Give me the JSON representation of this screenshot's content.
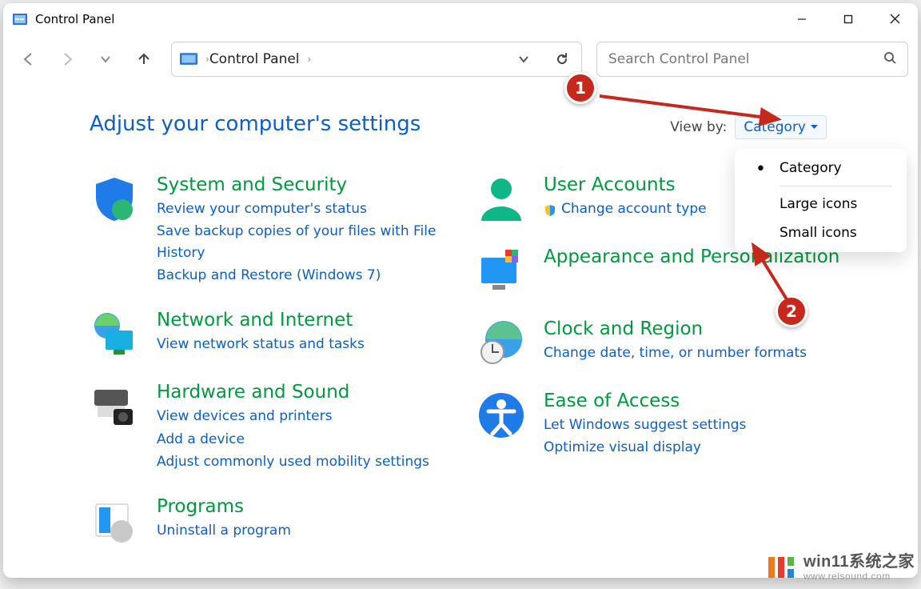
{
  "window": {
    "title": "Control Panel"
  },
  "address": {
    "crumbs": [
      "Control Panel"
    ]
  },
  "search": {
    "placeholder": "Search Control Panel"
  },
  "page": {
    "heading": "Adjust your computer's settings"
  },
  "viewby": {
    "label": "View by:",
    "selected": "Category",
    "options": [
      "Category",
      "Large icons",
      "Small icons"
    ],
    "selectedIndex": 0
  },
  "categories_left": [
    {
      "icon": "shield-icon",
      "title": "System and Security",
      "links": [
        {
          "shield": false,
          "text": "Review your computer's status"
        },
        {
          "shield": false,
          "text": "Save backup copies of your files with File History"
        },
        {
          "shield": false,
          "text": "Backup and Restore (Windows 7)"
        }
      ]
    },
    {
      "icon": "globe-monitor-icon",
      "title": "Network and Internet",
      "links": [
        {
          "shield": false,
          "text": "View network status and tasks"
        }
      ]
    },
    {
      "icon": "printer-camera-icon",
      "title": "Hardware and Sound",
      "links": [
        {
          "shield": false,
          "text": "View devices and printers"
        },
        {
          "shield": false,
          "text": "Add a device"
        },
        {
          "shield": false,
          "text": "Adjust commonly used mobility settings"
        }
      ]
    },
    {
      "icon": "programs-icon",
      "title": "Programs",
      "links": [
        {
          "shield": false,
          "text": "Uninstall a program"
        }
      ]
    }
  ],
  "categories_right": [
    {
      "icon": "user-icon",
      "title": "User Accounts",
      "links": [
        {
          "shield": true,
          "text": "Change account type"
        }
      ]
    },
    {
      "icon": "appearance-icon",
      "title": "Appearance and Personalization",
      "links": []
    },
    {
      "icon": "clock-globe-icon",
      "title": "Clock and Region",
      "links": [
        {
          "shield": false,
          "text": "Change date, time, or number formats"
        }
      ]
    },
    {
      "icon": "ease-icon",
      "title": "Ease of Access",
      "links": [
        {
          "shield": false,
          "text": "Let Windows suggest settings"
        },
        {
          "shield": false,
          "text": "Optimize visual display"
        }
      ]
    }
  ],
  "annotations": {
    "marker1": "1",
    "marker2": "2"
  },
  "watermark": {
    "line1": "win11系统之家",
    "line2": "www.relsound.com"
  }
}
